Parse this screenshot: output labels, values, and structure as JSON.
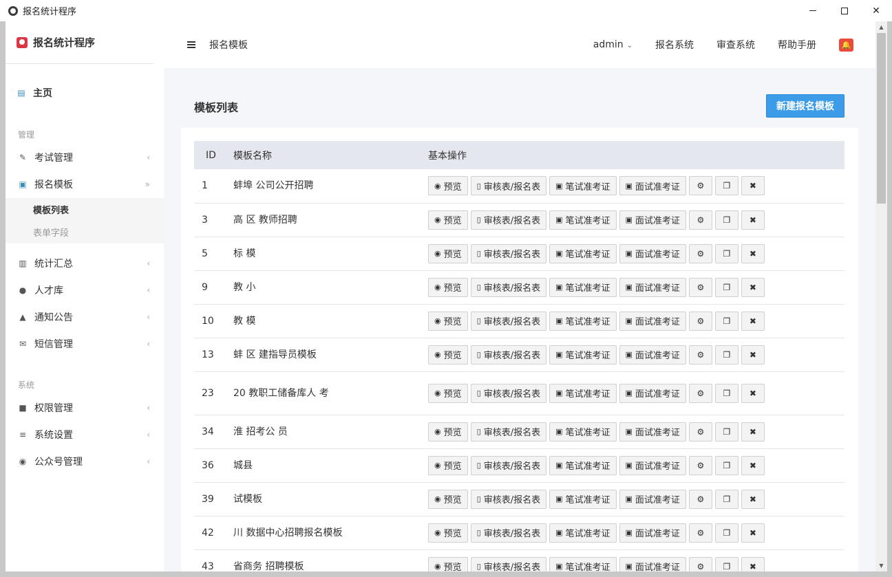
{
  "window": {
    "title": "报名统计程序"
  },
  "sidebar": {
    "brand": "报名统计程序",
    "home": "主页",
    "section_manage": "管理",
    "section_system": "系统",
    "items": [
      {
        "label": "考试管理",
        "icon": "edit-icon"
      },
      {
        "label": "报名模板",
        "icon": "id-card-icon"
      },
      {
        "label": "统计汇总",
        "icon": "bar-chart-icon"
      },
      {
        "label": "人才库",
        "icon": "users-icon"
      },
      {
        "label": "通知公告",
        "icon": "bell-icon"
      },
      {
        "label": "短信管理",
        "icon": "envelope-icon"
      },
      {
        "label": "权限管理",
        "icon": "lock-icon"
      },
      {
        "label": "系统设置",
        "icon": "sliders-icon"
      },
      {
        "label": "公众号管理",
        "icon": "wechat-icon"
      }
    ],
    "sub_items": [
      {
        "label": "模板列表"
      },
      {
        "label": "表单字段"
      }
    ]
  },
  "header": {
    "breadcrumb": "报名模板",
    "user": "admin",
    "links": [
      "报名系统",
      "审查系统",
      "帮助手册"
    ]
  },
  "card": {
    "title": "模板列表",
    "new_button": "新建报名模板"
  },
  "table": {
    "columns": [
      "ID",
      "模板名称",
      "基本操作"
    ],
    "actions": {
      "preview": "预览",
      "audit_form": "审核表/报名表",
      "written_ticket": "笔试准考证",
      "interview_ticket": "面试准考证"
    },
    "rows": [
      {
        "id": "1",
        "name": "蚌埠  公司公开招聘"
      },
      {
        "id": "3",
        "name": "高  区  教师招聘"
      },
      {
        "id": "5",
        "name": "标  模"
      },
      {
        "id": "9",
        "name": "教  小"
      },
      {
        "id": "10",
        "name": "教  模"
      },
      {
        "id": "13",
        "name": "蚌  区  建指导员模板"
      },
      {
        "id": "23",
        "name": "20  教职工储备库人  考"
      },
      {
        "id": "34",
        "name": "淮  招考公  员"
      },
      {
        "id": "36",
        "name": "  城县"
      },
      {
        "id": "39",
        "name": "  试模板"
      },
      {
        "id": "42",
        "name": "  川  数据中心招聘报名模板"
      },
      {
        "id": "43",
        "name": "  省商务  招聘模板"
      }
    ]
  },
  "colors": {
    "primary": "#3c9ce8",
    "danger": "#e74c3c",
    "brand_logo": "#dc3545"
  }
}
